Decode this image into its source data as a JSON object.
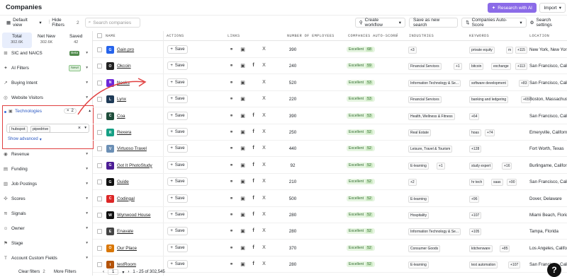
{
  "app": {
    "title": "Companies",
    "research_label": "Research with AI",
    "import_label": "Import"
  },
  "toolbar": {
    "view_label": "Default view",
    "hide_filters_label": "Hide Filters",
    "hide_filters_count": "2",
    "search_placeholder": "Search companies",
    "create_workflow_label": "Create workflow",
    "save_view_label": "Save as new search",
    "sort_label": "Companies Auto-Score",
    "settings_label": "Search settings"
  },
  "stats": [
    {
      "label": "Total",
      "value": "302.6K"
    },
    {
      "label": "Net New",
      "value": "302.6K"
    },
    {
      "label": "Saved",
      "value": "42"
    }
  ],
  "filters": {
    "sic": {
      "label": "SIC and NAICS",
      "badge": "Beta"
    },
    "ai": {
      "label": "AI Filters",
      "badge": "New!"
    },
    "buying": {
      "label": "Buying Intent"
    },
    "visitors": {
      "label": "Website Visitors"
    },
    "tech": {
      "label": "Technologies",
      "count": "2",
      "tags": [
        "hubspot",
        "pipedrive"
      ],
      "show_advanced": "Show advanced"
    },
    "revenue": {
      "label": "Revenue"
    },
    "funding": {
      "label": "Funding"
    },
    "jobs": {
      "label": "Job Postings"
    },
    "scores": {
      "label": "Scores"
    },
    "signals": {
      "label": "Signals"
    },
    "owner": {
      "label": "Owner"
    },
    "stage": {
      "label": "Stage"
    },
    "custom": {
      "label": "Account Custom Fields"
    }
  },
  "footer": {
    "clear_label": "Clear filters",
    "clear_count": "2",
    "more_label": "More Filters"
  },
  "pager": {
    "page": "1",
    "range": "1 - 25 of 302,545"
  },
  "columns": {
    "name": "NAME",
    "actions": "ACTIONS",
    "links": "LINKS",
    "employees": "NUMBER OF EMPLOYEES",
    "score": "COMPANIES AUTO-SCORE",
    "industries": "INDUSTRIES",
    "keywords": "KEYWORDS",
    "location": "LOCATION"
  },
  "save_label": "Save",
  "score_label": "Excellent",
  "colors": {
    "accent": "#8b6be8",
    "highlight": "#e04040",
    "score_bg": "#e6f5e1"
  },
  "rows": [
    {
      "name": "Gain.pro",
      "logo_color": "#2563eb",
      "fb": false,
      "emp": "390",
      "score": "68",
      "ind": [
        "+3"
      ],
      "kw": [
        "private equity",
        "m",
        "+115"
      ],
      "loc": "New York, New York"
    },
    {
      "name": "Okcoin",
      "logo_color": "#222222",
      "fb": true,
      "emp": "240",
      "score": "59",
      "ind": [
        "Financial Services",
        "+1"
      ],
      "kw": [
        "bitcoin",
        "exchange",
        "+113"
      ],
      "loc": "San Francisco, California"
    },
    {
      "name": "Nooks",
      "logo_color": "#6d28d9",
      "fb": false,
      "emp": "520",
      "score": "53",
      "ind": [
        "Information Technology & Se...",
        "+1"
      ],
      "kw": [
        "software development",
        "+83"
      ],
      "loc": "San Francisco, California"
    },
    {
      "name": "Lynx",
      "logo_color": "#1f3b57",
      "fb": false,
      "emp": "220",
      "score": "53",
      "ind": [
        "Financial Services"
      ],
      "kw": [
        "banking and ledgering",
        "+65"
      ],
      "loc": "Boston, Massachusetts"
    },
    {
      "name": "Coa",
      "logo_color": "#1e4d3a",
      "fb": true,
      "emp": "390",
      "score": "53",
      "ind": [
        "Health, Wellness & Fitness"
      ],
      "kw": [
        "+64"
      ],
      "loc": "San Francisco, California"
    },
    {
      "name": "Rexera",
      "logo_color": "#16a085",
      "fb": true,
      "emp": "250",
      "score": "52",
      "ind": [
        "Real Estate"
      ],
      "kw": [
        "hoas",
        "+74"
      ],
      "loc": "Emeryville, California"
    },
    {
      "name": "Virtuoso Travel",
      "logo_color": "#6b8fb5",
      "fb": true,
      "emp": "440",
      "score": "52",
      "ind": [
        "Leisure, Travel & Tourism"
      ],
      "kw": [
        "+128"
      ],
      "loc": "Fort Worth, Texas"
    },
    {
      "name": "Got It PhotoStudy",
      "logo_color": "#4c1d95",
      "fb": true,
      "emp": "92",
      "score": "52",
      "ind": [
        "E-learning",
        "+1"
      ],
      "kw": [
        "study expert",
        "+16"
      ],
      "loc": "Burlingame, California"
    },
    {
      "name": "Guide",
      "logo_color": "#111111",
      "fb": true,
      "emp": "210",
      "score": "52",
      "ind": [
        "+2"
      ],
      "kw": [
        "hr tech",
        "saas",
        "+90"
      ],
      "loc": "San Francisco, California"
    },
    {
      "name": "Codingal",
      "logo_color": "#dc2626",
      "fb": true,
      "emp": "500",
      "score": "52",
      "ind": [
        "E-learning"
      ],
      "kw": [
        "+96"
      ],
      "loc": "Dover, Delaware"
    },
    {
      "name": "Wynwood House",
      "logo_color": "#111111",
      "fb": true,
      "emp": "280",
      "score": "52",
      "ind": [
        "Hospitality"
      ],
      "kw": [
        "+107"
      ],
      "loc": "Miami Beach, Florida"
    },
    {
      "name": "Enavate",
      "logo_color": "#444444",
      "fb": true,
      "emp": "280",
      "score": "52",
      "ind": [
        "Information Technology & Se..."
      ],
      "kw": [
        "+105"
      ],
      "loc": "Tampa, Florida"
    },
    {
      "name": "Our Place",
      "logo_color": "#d97706",
      "fb": true,
      "emp": "370",
      "score": "52",
      "ind": [
        "Consumer Goods"
      ],
      "kw": [
        "kitchenware",
        "+85"
      ],
      "loc": "Los Angeles, California"
    },
    {
      "name": "testRoom",
      "logo_color": "#b45309",
      "fb": true,
      "emp": "280",
      "score": "52",
      "ind": [
        "E-learning"
      ],
      "kw": [
        "test automation",
        "+107"
      ],
      "loc": "San Francisco, California"
    }
  ]
}
